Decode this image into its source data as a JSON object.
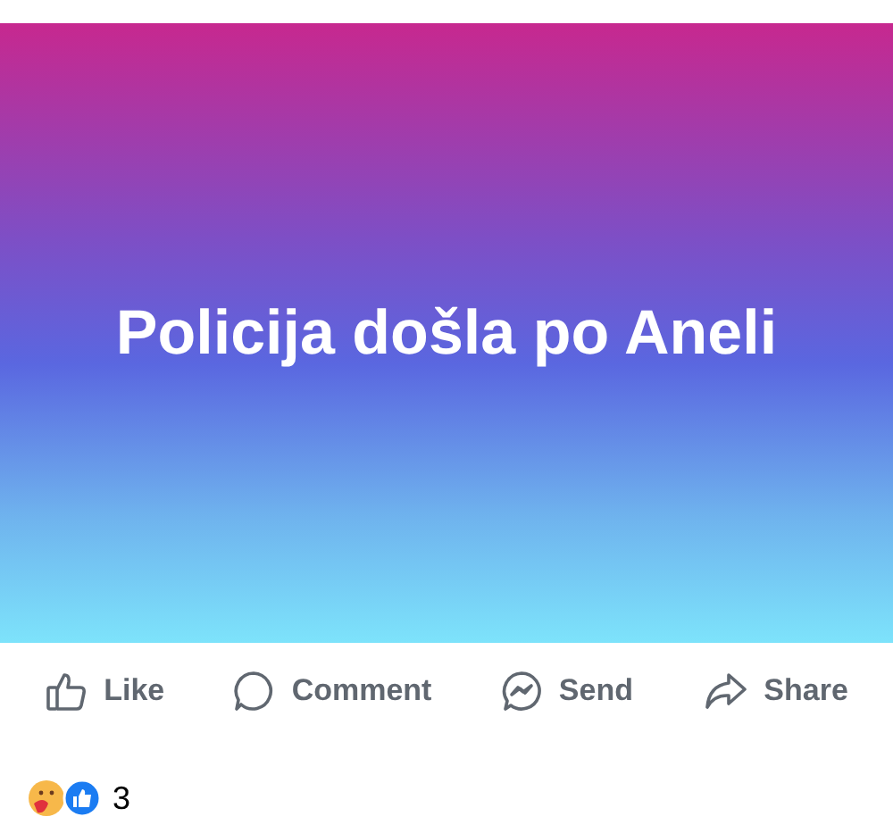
{
  "post": {
    "text": "Policija došla po Aneli"
  },
  "actions": [
    {
      "kind": "like",
      "label": "Like"
    },
    {
      "kind": "comment",
      "label": "Comment"
    },
    {
      "kind": "send",
      "label": "Send"
    },
    {
      "kind": "share",
      "label": "Share"
    }
  ],
  "reactions": {
    "count": "3"
  }
}
